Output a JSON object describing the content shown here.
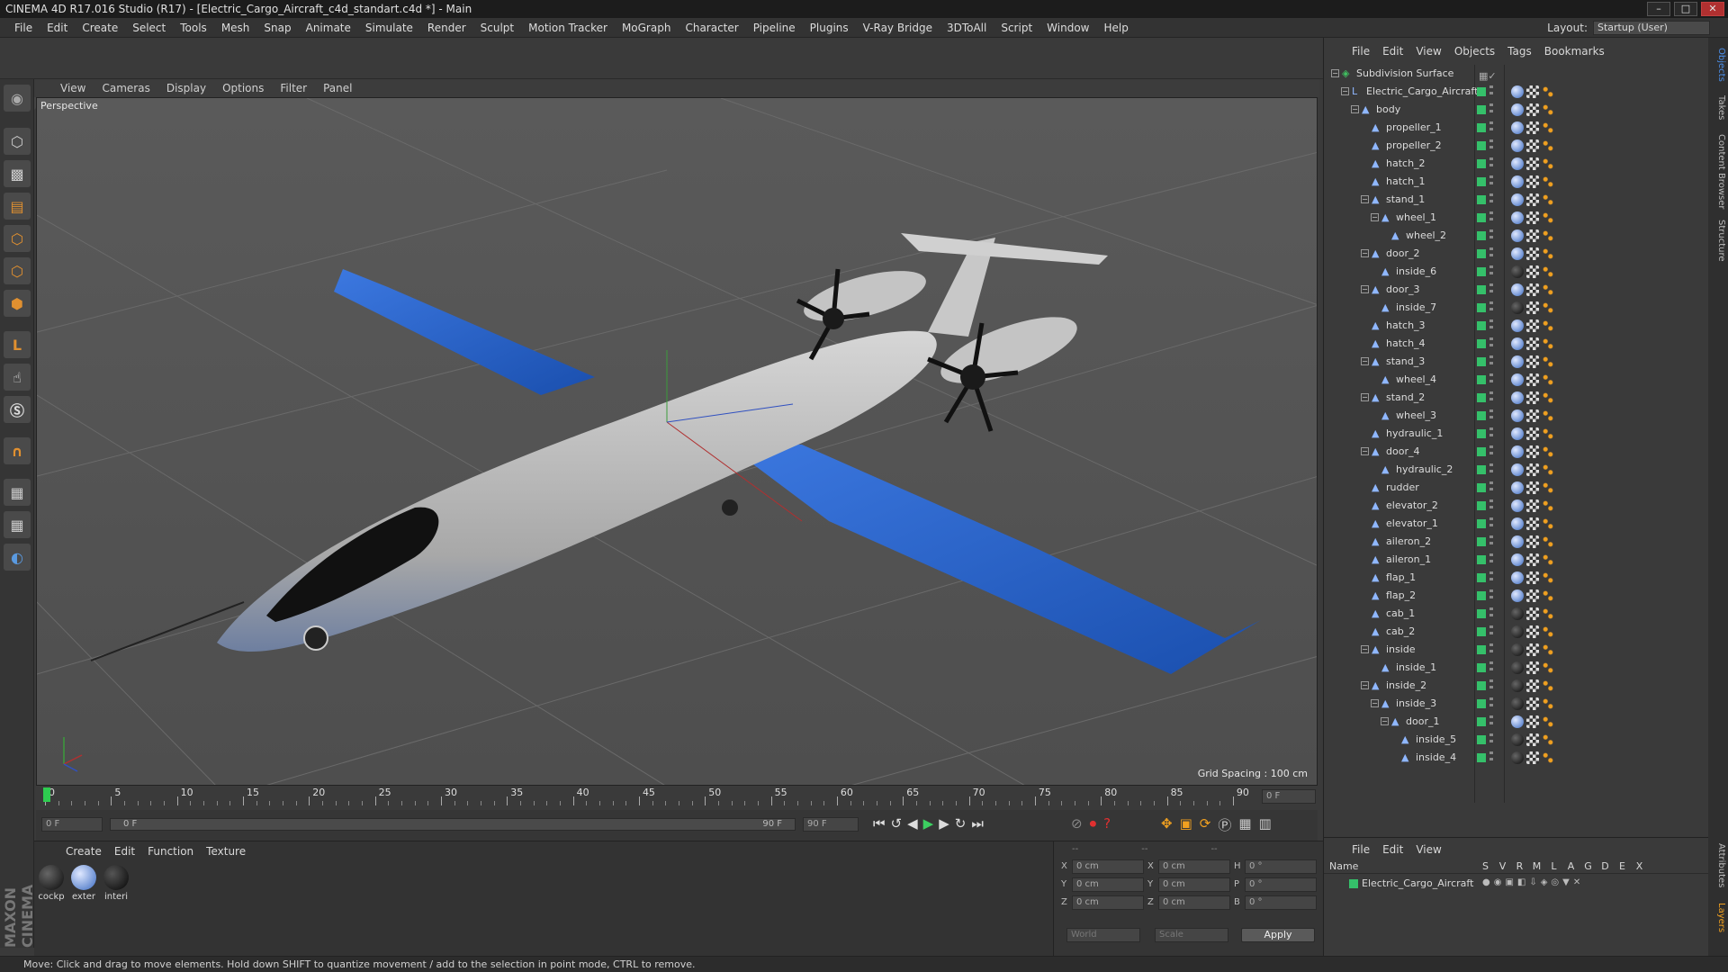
{
  "window": {
    "title": "CINEMA 4D R17.016 Studio (R17) - [Electric_Cargo_Aircraft_c4d_standart.c4d *] - Main"
  },
  "menu": [
    "File",
    "Edit",
    "Create",
    "Select",
    "Tools",
    "Mesh",
    "Snap",
    "Animate",
    "Simulate",
    "Render",
    "Sculpt",
    "Motion Tracker",
    "MoGraph",
    "Character",
    "Pipeline",
    "Plugins",
    "V-Ray Bridge",
    "3DToAll",
    "Script",
    "Window",
    "Help"
  ],
  "layout": {
    "label": "Layout:",
    "value": "Startup (User)"
  },
  "viewport": {
    "menu": [
      "View",
      "Cameras",
      "Display",
      "Options",
      "Filter",
      "Panel"
    ],
    "camera_label": "Perspective",
    "grid_spacing": "Grid Spacing : 100 cm"
  },
  "timeline": {
    "ticks": [
      "0",
      "5",
      "10",
      "15",
      "20",
      "25",
      "30",
      "35",
      "40",
      "45",
      "50",
      "55",
      "60",
      "65",
      "70",
      "75",
      "80",
      "85",
      "90"
    ],
    "current_frame": "0 F",
    "start_field": "0 F",
    "range_start": "0 F",
    "range_end": "90 F",
    "end_field": "90 F"
  },
  "materials": {
    "menu": [
      "Create",
      "Edit",
      "Function",
      "Texture"
    ],
    "items": [
      {
        "label": "cockp"
      },
      {
        "label": "exter"
      },
      {
        "label": "interi"
      }
    ]
  },
  "coords": {
    "header": [
      "--",
      "--",
      "--"
    ],
    "rows": [
      {
        "a": "X",
        "av": "0 cm",
        "b": "X",
        "bv": "0 cm",
        "c": "H",
        "cv": "0 °"
      },
      {
        "a": "Y",
        "av": "0 cm",
        "b": "Y",
        "bv": "0 cm",
        "c": "P",
        "cv": "0 °"
      },
      {
        "a": "Z",
        "av": "0 cm",
        "b": "Z",
        "bv": "0 cm",
        "c": "B",
        "cv": "0 °"
      }
    ],
    "mode": "World",
    "scale": "Scale",
    "apply": "Apply"
  },
  "object_manager": {
    "menu": [
      "File",
      "Edit",
      "View",
      "Objects",
      "Tags",
      "Bookmarks"
    ],
    "objects": [
      {
        "name": "Subdivision Surface",
        "depth": 0,
        "type": "subdiv"
      },
      {
        "name": "Electric_Cargo_Aircraft",
        "depth": 1,
        "type": "null"
      },
      {
        "name": "body",
        "depth": 2,
        "type": "poly"
      },
      {
        "name": "propeller_1",
        "depth": 3,
        "type": "poly"
      },
      {
        "name": "propeller_2",
        "depth": 3,
        "type": "poly"
      },
      {
        "name": "hatch_2",
        "depth": 3,
        "type": "poly"
      },
      {
        "name": "hatch_1",
        "depth": 3,
        "type": "poly"
      },
      {
        "name": "stand_1",
        "depth": 3,
        "type": "poly"
      },
      {
        "name": "wheel_1",
        "depth": 4,
        "type": "poly"
      },
      {
        "name": "wheel_2",
        "depth": 5,
        "type": "poly"
      },
      {
        "name": "door_2",
        "depth": 3,
        "type": "poly"
      },
      {
        "name": "inside_6",
        "depth": 4,
        "type": "poly"
      },
      {
        "name": "door_3",
        "depth": 3,
        "type": "poly"
      },
      {
        "name": "inside_7",
        "depth": 4,
        "type": "poly"
      },
      {
        "name": "hatch_3",
        "depth": 3,
        "type": "poly"
      },
      {
        "name": "hatch_4",
        "depth": 3,
        "type": "poly"
      },
      {
        "name": "stand_3",
        "depth": 3,
        "type": "poly"
      },
      {
        "name": "wheel_4",
        "depth": 4,
        "type": "poly"
      },
      {
        "name": "stand_2",
        "depth": 3,
        "type": "poly"
      },
      {
        "name": "wheel_3",
        "depth": 4,
        "type": "poly"
      },
      {
        "name": "hydraulic_1",
        "depth": 3,
        "type": "poly"
      },
      {
        "name": "door_4",
        "depth": 3,
        "type": "poly"
      },
      {
        "name": "hydraulic_2",
        "depth": 4,
        "type": "poly"
      },
      {
        "name": "rudder",
        "depth": 3,
        "type": "poly"
      },
      {
        "name": "elevator_2",
        "depth": 3,
        "type": "poly"
      },
      {
        "name": "elevator_1",
        "depth": 3,
        "type": "poly"
      },
      {
        "name": "aileron_2",
        "depth": 3,
        "type": "poly"
      },
      {
        "name": "aileron_1",
        "depth": 3,
        "type": "poly"
      },
      {
        "name": "flap_1",
        "depth": 3,
        "type": "poly"
      },
      {
        "name": "flap_2",
        "depth": 3,
        "type": "poly"
      },
      {
        "name": "cab_1",
        "depth": 3,
        "type": "poly"
      },
      {
        "name": "cab_2",
        "depth": 3,
        "type": "poly"
      },
      {
        "name": "inside",
        "depth": 3,
        "type": "poly"
      },
      {
        "name": "inside_1",
        "depth": 4,
        "type": "poly"
      },
      {
        "name": "inside_2",
        "depth": 3,
        "type": "poly"
      },
      {
        "name": "inside_3",
        "depth": 4,
        "type": "poly"
      },
      {
        "name": "door_1",
        "depth": 5,
        "type": "poly"
      },
      {
        "name": "inside_5",
        "depth": 6,
        "type": "poly"
      },
      {
        "name": "inside_4",
        "depth": 6,
        "type": "poly"
      }
    ]
  },
  "layer_manager": {
    "menu": [
      "File",
      "Edit",
      "View"
    ],
    "columns": {
      "name": "Name",
      "flags": [
        "S",
        "V",
        "R",
        "M",
        "L",
        "A",
        "G",
        "D",
        "E",
        "X"
      ]
    },
    "rows": [
      {
        "name": "Electric_Cargo_Aircraft"
      }
    ]
  },
  "side_tabs": [
    "Objects",
    "Takes",
    "Content Browser",
    "Structure",
    "Attributes",
    "Layers"
  ],
  "status": "Move: Click and drag to move elements. Hold down SHIFT to quantize movement / add to the selection in point mode, CTRL to remove.",
  "colors": {
    "accent": "#4b8ee8",
    "green": "#35c06a",
    "wing_blue": "#1f5cc4"
  }
}
